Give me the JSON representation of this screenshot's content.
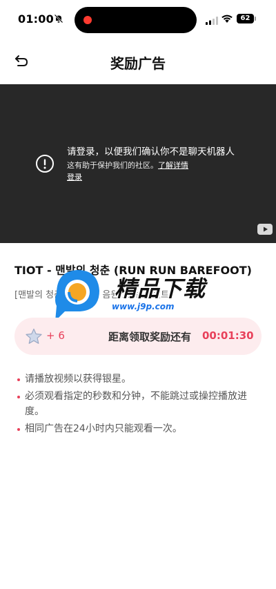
{
  "status_bar": {
    "time": "01:00",
    "battery": "62"
  },
  "header": {
    "title": "奖励广告"
  },
  "video": {
    "notice_title": "请登录，以便我们确认你不是聊天机器人",
    "notice_sub": "这有助于保护我们的社区。",
    "learn_more": "了解详情",
    "login": "登录"
  },
  "content": {
    "video_title": "TIOT - 맨발의 청춘 (RUN RUN BAREFOOT)",
    "video_desc": "[맨발의 청춘] ... 넘 ... 음원 ... 보 이벤트"
  },
  "watermark": {
    "text": "精品下载",
    "url": "www.j9p.com"
  },
  "reward": {
    "plus": "+ 6",
    "label": "距离领取奖励还有",
    "timer": "00:01:30",
    "accent": "#e8405a",
    "bg": "#fdecee"
  },
  "rules": [
    "请播放视频以获得银星。",
    "必须观看指定的秒数和分钟，不能跳过或操控播放进度。",
    "相同广告在24小时内只能观看一次。"
  ]
}
